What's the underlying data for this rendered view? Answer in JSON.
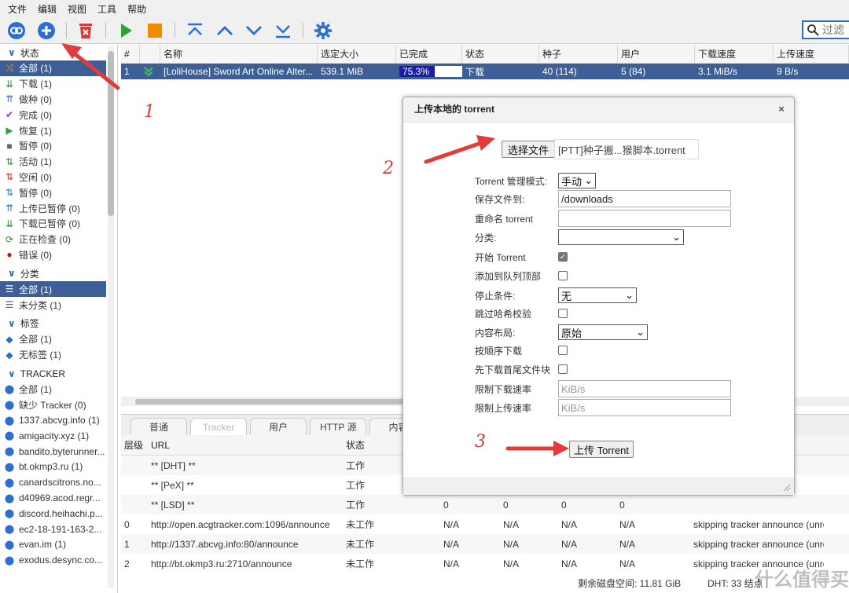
{
  "menu": [
    "文件",
    "编辑",
    "视图",
    "工具",
    "帮助"
  ],
  "toolbar": {
    "filter_placeholder": "过滤"
  },
  "sidebar": {
    "status_header": "状态",
    "status_items": [
      {
        "label": "全部 (1)",
        "icon": "shuffle-icon",
        "color": "#e08a1e"
      },
      {
        "label": "下载 (1)",
        "icon": "download-icon",
        "color": "#2e8b3a"
      },
      {
        "label": "做种 (0)",
        "icon": "upload-icon",
        "color": "#3a6fc4"
      },
      {
        "label": "完成 (0)",
        "icon": "check-icon",
        "color": "#8a3ac4"
      },
      {
        "label": "恢复 (1)",
        "icon": "play-icon",
        "color": "#2ea33a"
      },
      {
        "label": "暂停 (0)",
        "icon": "stop-icon",
        "color": "#666666"
      },
      {
        "label": "活动 (1)",
        "icon": "active-icon",
        "color": "#2e8b3a"
      },
      {
        "label": "空闲 (0)",
        "icon": "inactive-icon",
        "color": "#d03030"
      },
      {
        "label": "暂停 (0)",
        "icon": "stalled-icon",
        "color": "#2e7bc4"
      },
      {
        "label": "上传已暂停 (0)",
        "icon": "upload-paused-icon",
        "color": "#3a6fc4"
      },
      {
        "label": "下载已暂停 (0)",
        "icon": "download-paused-icon",
        "color": "#2e8b3a"
      },
      {
        "label": "正在检查 (0)",
        "icon": "checking-icon",
        "color": "#2e8b3a"
      },
      {
        "label": "错误 (0)",
        "icon": "error-icon",
        "color": "#d01010"
      }
    ],
    "category_header": "分类",
    "category_items": [
      "全部 (1)",
      "未分类 (1)"
    ],
    "tag_header": "标签",
    "tag_items": [
      "全部 (1)",
      "无标签 (1)"
    ],
    "tracker_header": "TRACKER",
    "tracker_items": [
      "全部 (1)",
      "缺少 Tracker (0)",
      "1337.abcvg.info (1)",
      "amigacity.xyz (1)",
      "bandito.byterunner...",
      "bt.okmp3.ru (1)",
      "canardscitrons.no...",
      "d40969.acod.regr...",
      "discord.heihachi.p...",
      "ec2-18-191-163-2...",
      "evan.im (1)",
      "exodus.desync.co..."
    ]
  },
  "transfer": {
    "columns": [
      "#",
      "",
      "名称",
      "选定大小",
      "已完成",
      "状态",
      "种子",
      "用户",
      "下载速度",
      "上传速度"
    ],
    "row": {
      "index": "1",
      "name": "[LoliHouse] Sword Art Online Alter...",
      "size": "539.1 MiB",
      "progress_text": "75.3%",
      "progress": 0.753,
      "state": "下载",
      "seeds": "40 (114)",
      "peers": "5 (84)",
      "dl_speed": "3.1 MiB/s",
      "ul_speed": "9 B/s"
    }
  },
  "props": {
    "tabs": [
      "普通",
      "Tracker",
      "用户",
      "HTTP 源",
      "内容"
    ],
    "tracker_columns": [
      "层级",
      "URL",
      "状态"
    ],
    "tracker_rows": [
      {
        "tier": "",
        "url": "** [DHT] **",
        "status": "工作",
        "c1": "",
        "c2": "",
        "c3": "",
        "c4": "",
        "msg": ""
      },
      {
        "tier": "",
        "url": "** [PeX] **",
        "status": "工作",
        "c1": "",
        "c2": "",
        "c3": "",
        "c4": "",
        "msg": ""
      },
      {
        "tier": "",
        "url": "** [LSD] **",
        "status": "工作",
        "c1": "0",
        "c2": "0",
        "c3": "0",
        "c4": "0",
        "msg": ""
      },
      {
        "tier": "0",
        "url": "http://open.acgtracker.com:1096/announce",
        "status": "未工作",
        "c1": "N/A",
        "c2": "N/A",
        "c3": "N/A",
        "c4": "N/A",
        "msg": "skipping tracker announce (unreacha"
      },
      {
        "tier": "1",
        "url": "http://1337.abcvg.info:80/announce",
        "status": "未工作",
        "c1": "N/A",
        "c2": "N/A",
        "c3": "N/A",
        "c4": "N/A",
        "msg": "skipping tracker announce (unreacha"
      },
      {
        "tier": "2",
        "url": "http://bt.okmp3.ru:2710/announce",
        "status": "未工作",
        "c1": "N/A",
        "c2": "N/A",
        "c3": "N/A",
        "c4": "N/A",
        "msg": "skipping tracker announce (unreacha"
      }
    ]
  },
  "dialog": {
    "title": "上传本地的 torrent",
    "choose_file": "选择文件",
    "file_name": "[PTT]种子搬...猴脚本.torrent",
    "fields": {
      "mode_label": "Torrent 管理模式:",
      "mode_value": "手动",
      "save_label": "保存文件到:",
      "save_value": "/downloads",
      "rename_label": "重命名 torrent",
      "category_label": "分类:",
      "start_label": "开始 Torrent",
      "top_label": "添加到队列顶部",
      "stop_label": "停止条件:",
      "stop_value": "无",
      "skip_label": "跳过哈希校验",
      "layout_label": "内容布局:",
      "layout_value": "原始",
      "seq_label": "按顺序下载",
      "first_last_label": "先下载首尾文件块",
      "dl_limit_label": "限制下载速率",
      "ul_limit_label": "限制上传速率",
      "speed_placeholder": "KiB/s"
    },
    "upload_button": "上传 Torrent"
  },
  "annotations": {
    "one": "1",
    "two": "2",
    "three": "3"
  },
  "statusbar": {
    "disk": "剩余磁盘空间: 11.81 GiB",
    "dht": "DHT: 33 结点"
  },
  "watermark": "什么值得买"
}
